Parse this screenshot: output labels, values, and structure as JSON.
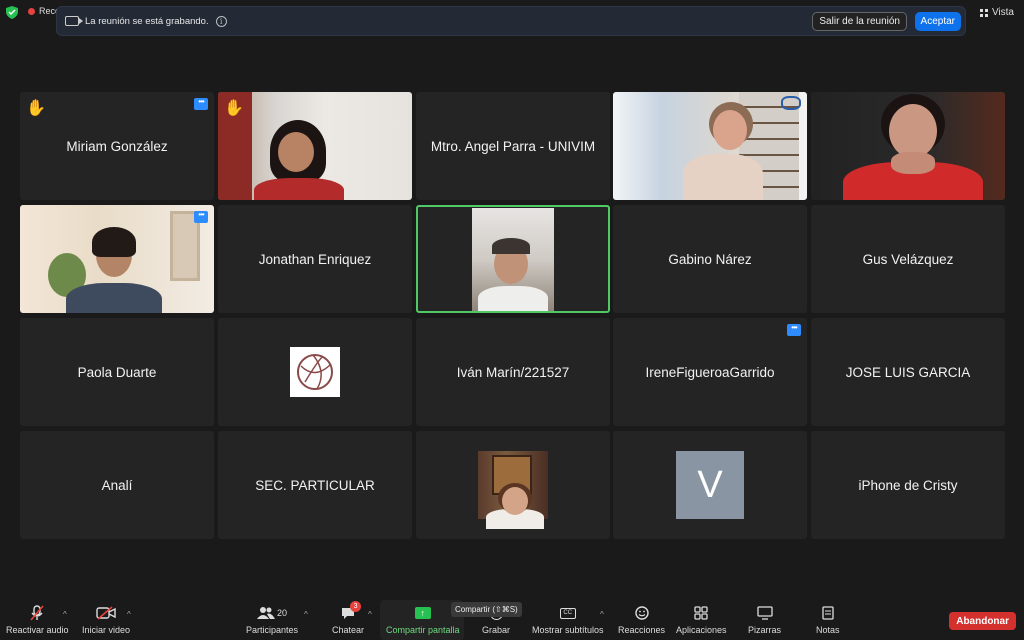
{
  "topbar": {
    "rec_label": "Reco",
    "banner_msg": "La reunión se está grabando.",
    "leave_meeting_btn": "Salir de la reunión",
    "accept_btn": "Aceptar",
    "view_label": "Vista"
  },
  "tiles": [
    {
      "name": "Miriam González",
      "hand": true,
      "more": true
    },
    {
      "name": "",
      "video": "woman-red",
      "hand": true
    },
    {
      "name": "Mtro. Angel Parra - UNIVIM"
    },
    {
      "name": "",
      "video": "woman-glasses"
    },
    {
      "name": "",
      "video": "woman-hands"
    },
    {
      "name": "",
      "video": "man-young",
      "more": true
    },
    {
      "name": "Jonathan Enriquez"
    },
    {
      "name": "",
      "video": "man-speaker",
      "active": true
    },
    {
      "name": "Gabino Nárez"
    },
    {
      "name": "Gus Velázquez"
    },
    {
      "name": "Paola Duarte"
    },
    {
      "name": "",
      "avatar": "globe"
    },
    {
      "name": "Iván Marín/221527"
    },
    {
      "name": "IreneFigueroaGarrido",
      "more": true
    },
    {
      "name": "JOSE LUIS GARCIA"
    },
    {
      "name": "Analí"
    },
    {
      "name": "SEC. PARTICULAR"
    },
    {
      "name": "",
      "video": "woman-painting"
    },
    {
      "name": "",
      "avatar_letter": "V"
    },
    {
      "name": "iPhone de Cristy"
    }
  ],
  "toolbar": {
    "audio_label": "Reactivar audio",
    "video_label": "Iniciar video",
    "participants_label": "Participantes",
    "participants_count": "20",
    "chat_label": "Chatear",
    "chat_badge": "3",
    "share_label": "Compartir pantalla",
    "share_tooltip": "Compartir (⇧⌘S)",
    "record_label": "Grabar",
    "subtitles_label": "Mostrar subtítulos",
    "subtitles_icon_text": "CC",
    "reactions_label": "Reacciones",
    "apps_label": "Aplicaciones",
    "whiteboards_label": "Pizarras",
    "notes_label": "Notas",
    "leave_label": "Abandonar"
  },
  "colors": {
    "accent": "#0e72ed",
    "active_speaker": "#4fc865",
    "leave": "#d3302e",
    "share": "#27c152"
  }
}
